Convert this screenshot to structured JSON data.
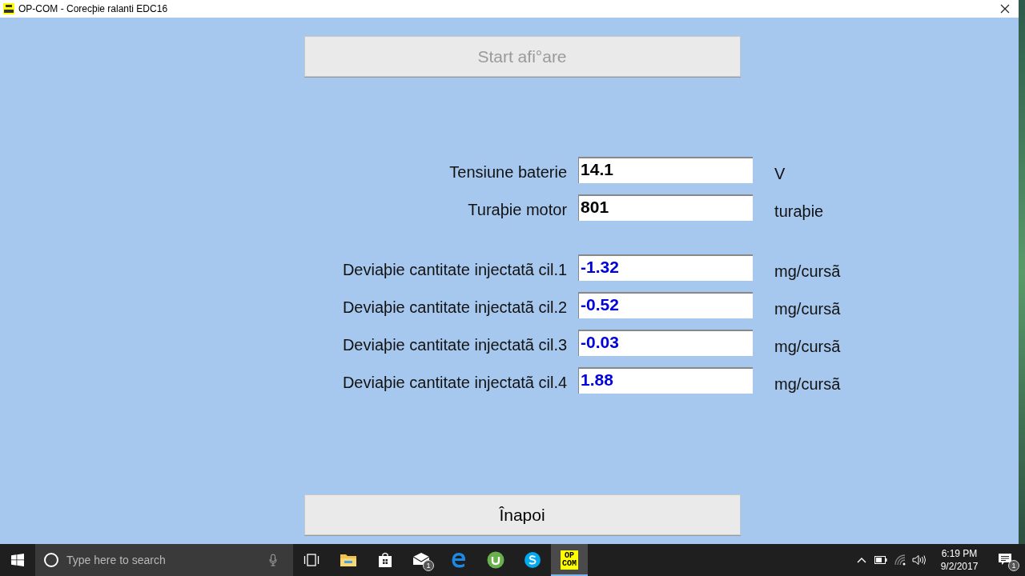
{
  "window": {
    "title": "OP-COM - Corecþie ralanti EDC16"
  },
  "start_button": {
    "label": "Start afi°are",
    "disabled": true
  },
  "readings": [
    {
      "label": "Tensiune baterie",
      "value": "14.1",
      "unit": "V",
      "color": "#000000"
    },
    {
      "label": "Turaþie motor",
      "value": "801",
      "unit": "turaþie",
      "color": "#000000"
    }
  ],
  "deviations": [
    {
      "label": "Deviaþie cantitate injectatã cil.1",
      "value": "-1.32",
      "unit": "mg/cursã",
      "color": "#0000dd"
    },
    {
      "label": "Deviaþie cantitate injectatã cil.2",
      "value": "-0.52",
      "unit": "mg/cursã",
      "color": "#0000dd"
    },
    {
      "label": "Deviaþie cantitate injectatã cil.3",
      "value": "-0.03",
      "unit": "mg/cursã",
      "color": "#0000dd"
    },
    {
      "label": "Deviaþie cantitate injectatã cil.4",
      "value": "1.88",
      "unit": "mg/cursã",
      "color": "#0000dd"
    }
  ],
  "back_button": {
    "label": "Înapoi",
    "disabled": false
  },
  "taskbar": {
    "search": {
      "placeholder": "Type here to search"
    },
    "apps": [
      {
        "kind": "taskview",
        "selected": false
      },
      {
        "kind": "folder",
        "selected": false
      },
      {
        "kind": "store",
        "selected": false
      },
      {
        "kind": "mail",
        "selected": false,
        "badge": "1"
      },
      {
        "kind": "edge",
        "selected": false
      },
      {
        "kind": "torrent",
        "selected": false
      },
      {
        "kind": "skype",
        "selected": false
      },
      {
        "kind": "opcom",
        "selected": true,
        "text": [
          "OP",
          "COM"
        ]
      }
    ],
    "time": "6:19 PM",
    "date": "9/2/2017",
    "notification_badge": "1"
  }
}
